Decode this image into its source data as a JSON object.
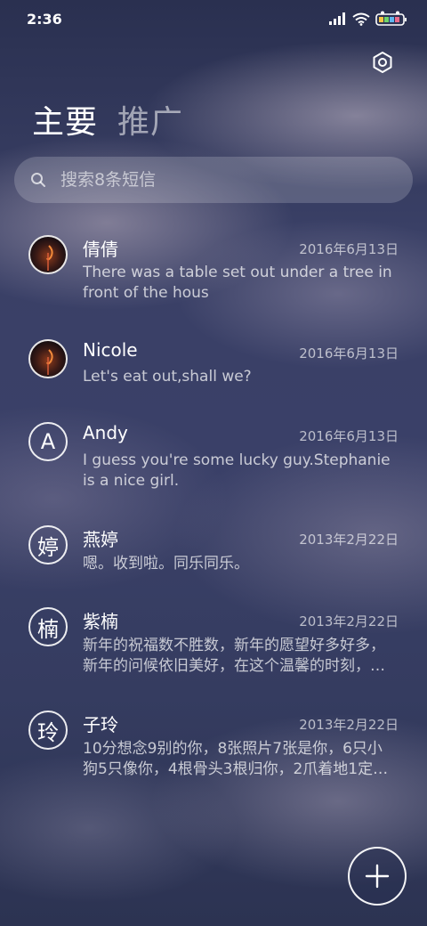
{
  "status_bar": {
    "time": "2:36",
    "icons": [
      "signal-icon",
      "wifi-icon",
      "battery-icon"
    ]
  },
  "header": {
    "settings_icon": "settings-gear-icon",
    "tabs": [
      {
        "label": "主要",
        "active": true
      },
      {
        "label": "推广",
        "active": false
      }
    ]
  },
  "search": {
    "placeholder": "搜索8条短信",
    "value": ""
  },
  "conversations": [
    {
      "name": "倩倩",
      "date": "2016年6月13日",
      "preview": "There was a table set out under a tree in front of the hous",
      "avatar": "photo",
      "avatar_text": ""
    },
    {
      "name": "Nicole",
      "date": "2016年6月13日",
      "preview": "Let's eat out,shall we?",
      "avatar": "photo",
      "avatar_text": ""
    },
    {
      "name": "Andy",
      "date": "2016年6月13日",
      "preview": "I guess you're some lucky guy.Stephanie is a nice girl.",
      "avatar": "letter",
      "avatar_text": "A"
    },
    {
      "name": "燕婷",
      "date": "2013年2月22日",
      "preview": "嗯。收到啦。同乐同乐。",
      "avatar": "letter",
      "avatar_text": "婷"
    },
    {
      "name": "紫楠",
      "date": "2013年2月22日",
      "preview": "新年的祝福数不胜数，新年的愿望好多好多，新年的问候依旧美好，在这个温馨的时刻，…",
      "avatar": "letter",
      "avatar_text": "楠"
    },
    {
      "name": "子玲",
      "date": "2013年2月22日",
      "preview": "10分想念9别的你，8张照片7张是你，6只小狗5只像你，4根骨头3根归你，2爪着地1定…",
      "avatar": "letter",
      "avatar_text": "玲"
    }
  ],
  "fab": {
    "icon": "plus-icon"
  },
  "colors": {
    "background": "#3a4066",
    "text": "#ffffff"
  }
}
